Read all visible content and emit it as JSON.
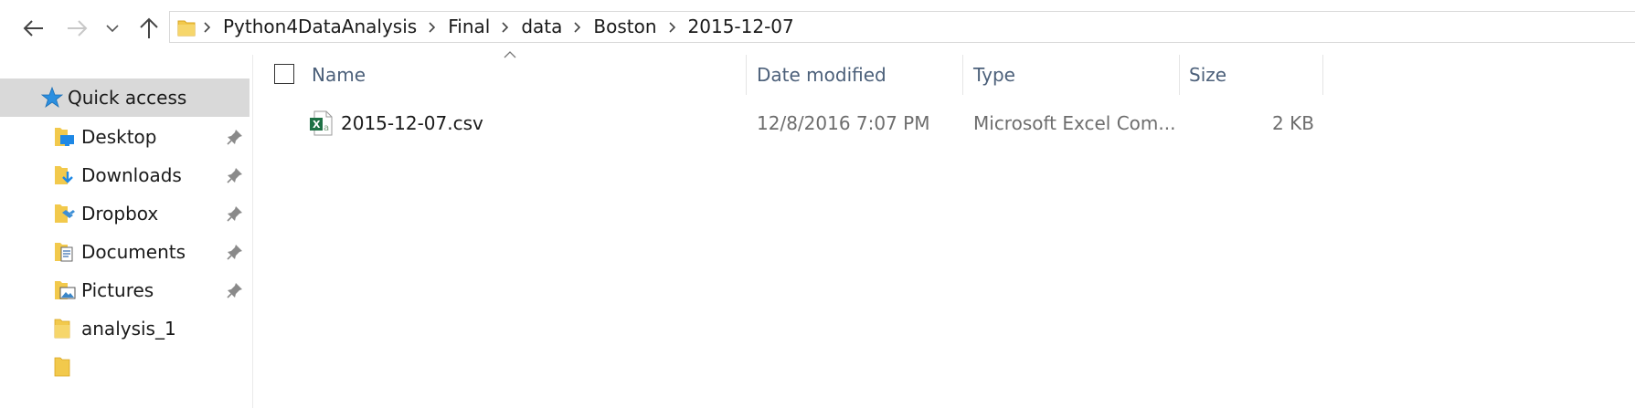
{
  "navigation": {
    "back_icon": "arrow-left-icon",
    "forward_icon": "arrow-right-icon",
    "recent_icon": "chevron-down-icon",
    "up_icon": "arrow-up-icon"
  },
  "address_bar": {
    "breadcrumbs": [
      "Python4DataAnalysis",
      "Final",
      "data",
      "Boston",
      "2015-12-07"
    ]
  },
  "sidebar": {
    "quick_access": {
      "label": "Quick access",
      "icon": "star-icon"
    },
    "items": [
      {
        "label": "Desktop",
        "icon": "desktop-folder-icon",
        "pinned": true
      },
      {
        "label": "Downloads",
        "icon": "downloads-folder-icon",
        "pinned": true
      },
      {
        "label": "Dropbox",
        "icon": "dropbox-folder-icon",
        "pinned": true
      },
      {
        "label": "Documents",
        "icon": "documents-folder-icon",
        "pinned": true
      },
      {
        "label": "Pictures",
        "icon": "pictures-folder-icon",
        "pinned": true
      },
      {
        "label": "analysis_1",
        "icon": "folder-icon",
        "pinned": false
      }
    ]
  },
  "file_list": {
    "columns": [
      "Name",
      "Date modified",
      "Type",
      "Size"
    ],
    "sorted_by": "Name",
    "rows": [
      {
        "name": "2015-12-07.csv",
        "date_modified": "12/8/2016 7:07 PM",
        "type": "Microsoft Excel Com...",
        "size": "2 KB",
        "icon": "excel-csv-file-icon"
      }
    ]
  },
  "colors": {
    "selection_bg": "#d9d9d9",
    "header_text": "#4c607a",
    "muted_text": "#6d6d6d",
    "folder_yellow": "#f2c94c",
    "excel_green": "#1e7145",
    "star_blue": "#2b8fe0"
  }
}
